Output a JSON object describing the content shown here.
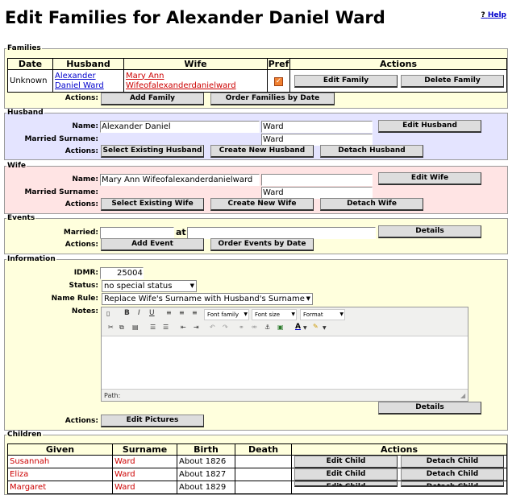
{
  "page": {
    "title": "Edit Families for Alexander Daniel Ward",
    "help_label": "Help",
    "help_mark": "?"
  },
  "families": {
    "legend": "Families",
    "headers": [
      "Date",
      "Husband",
      "Wife",
      "Pref",
      "Actions"
    ],
    "row": {
      "date": "Unknown",
      "husband_line1": "Alexander",
      "husband_line2": "Daniel Ward",
      "wife_line1": "Mary Ann",
      "wife_line2": "Wifeofalexanderdanielward",
      "edit_label": "Edit Family",
      "delete_label": "Delete Family"
    },
    "actions_label": "Actions:",
    "add_label": "Add Family",
    "order_label": "Order Families by Date"
  },
  "husband": {
    "legend": "Husband",
    "name_label": "Name:",
    "given": "Alexander Daniel",
    "surname": "Ward",
    "married_label": "Married Surname:",
    "married": "Ward",
    "actions_label": "Actions:",
    "edit_label": "Edit Husband",
    "select_label": "Select Existing Husband",
    "create_label": "Create New Husband",
    "detach_label": "Detach Husband"
  },
  "wife": {
    "legend": "Wife",
    "name_label": "Name:",
    "given": "Mary Ann Wifeofalexanderdanielward",
    "surname": "",
    "married_label": "Married Surname:",
    "married": "Ward",
    "actions_label": "Actions:",
    "edit_label": "Edit Wife",
    "select_label": "Select Existing Wife",
    "create_label": "Create New Wife",
    "detach_label": "Detach Wife"
  },
  "events": {
    "legend": "Events",
    "married_label": "Married:",
    "married_date": "",
    "at_label": "at",
    "married_place": "",
    "details_label": "Details",
    "actions_label": "Actions:",
    "add_label": "Add Event",
    "order_label": "Order Events by Date"
  },
  "information": {
    "legend": "Information",
    "idmr_label": "IDMR:",
    "idmr": "25004",
    "status_label": "Status:",
    "status": "no special status",
    "name_rule_label": "Name Rule:",
    "name_rule": "Replace Wife's Surname with Husband's Surname",
    "notes_label": "Notes:",
    "font_family": "Font family",
    "font_size": "Font size",
    "format": "Format",
    "path_label": "Path:",
    "details_label": "Details",
    "actions_label": "Actions:",
    "pictures_label": "Edit Pictures"
  },
  "children": {
    "legend": "Children",
    "headers": [
      "Given",
      "Surname",
      "Birth",
      "Death",
      "Actions"
    ],
    "edit_label": "Edit Child",
    "detach_label": "Detach Child",
    "rows": [
      {
        "given": "Susannah",
        "surname": "Ward",
        "birth": "About 1826",
        "death": ""
      },
      {
        "given": "Eliza",
        "surname": "Ward",
        "birth": "About 1827",
        "death": ""
      },
      {
        "given": "Margaret",
        "surname": "Ward",
        "birth": "About 1829",
        "death": ""
      }
    ]
  },
  "colors": {
    "yellow": "#ffffdd",
    "husband_bg": "#e4e4ff",
    "wife_bg": "#ffe4e4",
    "link_blue": "#0000cc",
    "link_red": "#cc0000"
  }
}
